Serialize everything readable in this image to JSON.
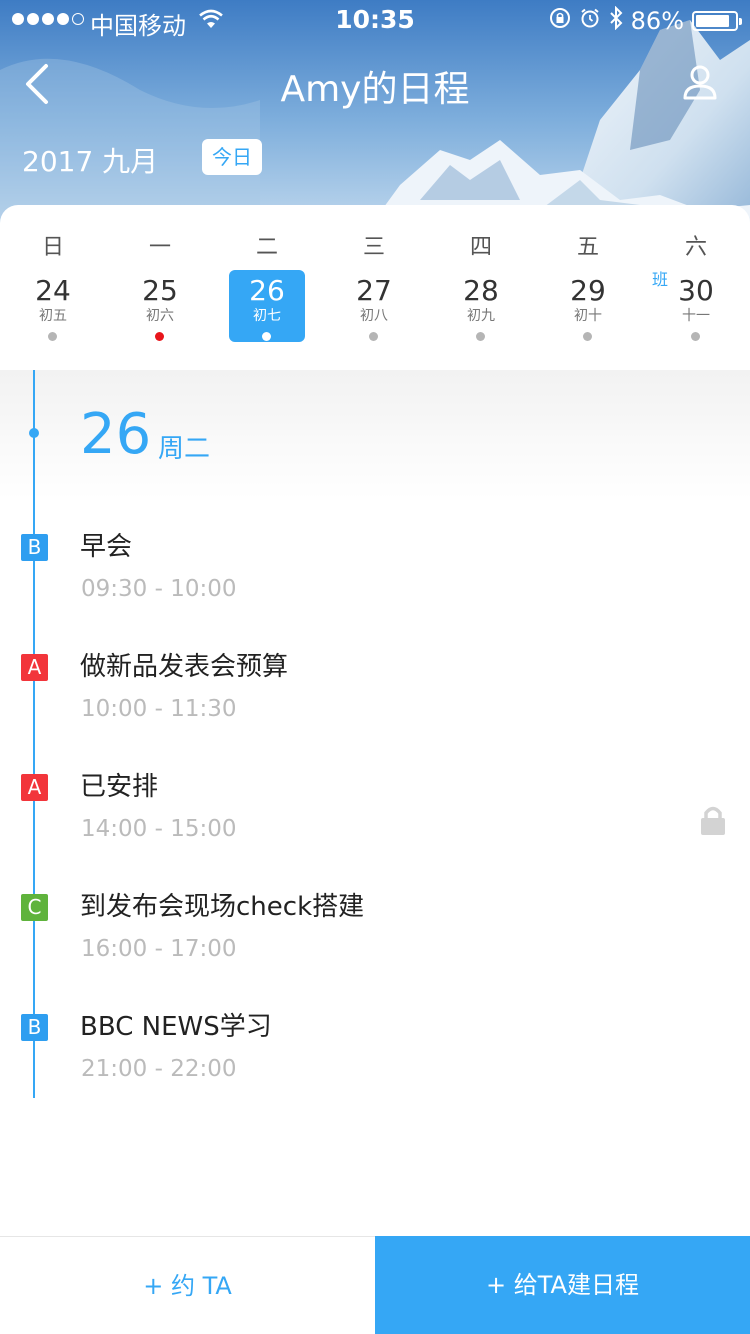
{
  "status_bar": {
    "carrier": "中国移动",
    "time": "10:35",
    "battery_percent_label": "86%",
    "battery_level": 0.86,
    "signal_bars_filled": 4,
    "signal_bars_total": 5,
    "icons": [
      "wifi-icon",
      "orientation-lock-icon",
      "alarm-icon",
      "bluetooth-icon",
      "battery-icon"
    ]
  },
  "header": {
    "title": "Amy的日程",
    "month_label": "2017 九月",
    "today_button": "今日",
    "back_icon": "chevron-left-icon",
    "profile_icon": "person-icon"
  },
  "week": {
    "headers": [
      "日",
      "一",
      "二",
      "三",
      "四",
      "五",
      "六"
    ],
    "days": [
      {
        "num": "24",
        "lunar": "初五",
        "dot": "gray",
        "selected": false,
        "badge": ""
      },
      {
        "num": "25",
        "lunar": "初六",
        "dot": "red",
        "selected": false,
        "badge": ""
      },
      {
        "num": "26",
        "lunar": "初七",
        "dot": "white",
        "selected": true,
        "badge": ""
      },
      {
        "num": "27",
        "lunar": "初八",
        "dot": "gray",
        "selected": false,
        "badge": ""
      },
      {
        "num": "28",
        "lunar": "初九",
        "dot": "gray",
        "selected": false,
        "badge": ""
      },
      {
        "num": "29",
        "lunar": "初十",
        "dot": "gray",
        "selected": false,
        "badge": ""
      },
      {
        "num": "30",
        "lunar": "十一",
        "dot": "gray",
        "selected": false,
        "badge": "班"
      }
    ]
  },
  "agenda": {
    "date_num": "26",
    "weekday": "周二",
    "events": [
      {
        "tag": "B",
        "tag_color": "#2e9ef0",
        "title": "早会",
        "time": "09:30 - 10:00",
        "locked": false
      },
      {
        "tag": "A",
        "tag_color": "#f2353b",
        "title": "做新品发表会预算",
        "time": "10:00 - 11:30",
        "locked": false
      },
      {
        "tag": "A",
        "tag_color": "#f2353b",
        "title": "已安排",
        "time": "14:00 - 15:00",
        "locked": true
      },
      {
        "tag": "C",
        "tag_color": "#5fb33c",
        "title": "到发布会现场check搭建",
        "time": "16:00 - 17:00",
        "locked": false
      },
      {
        "tag": "B",
        "tag_color": "#2e9ef0",
        "title": "BBC NEWS学习",
        "time": "21:00 - 22:00",
        "locked": false
      }
    ]
  },
  "bottom": {
    "invite_label": "+ 约 TA",
    "create_label": "+ 给TA建日程"
  },
  "colors": {
    "accent": "#35a7f5",
    "tag_a": "#f2353b",
    "tag_b": "#2e9ef0",
    "tag_c": "#5fb33c"
  }
}
